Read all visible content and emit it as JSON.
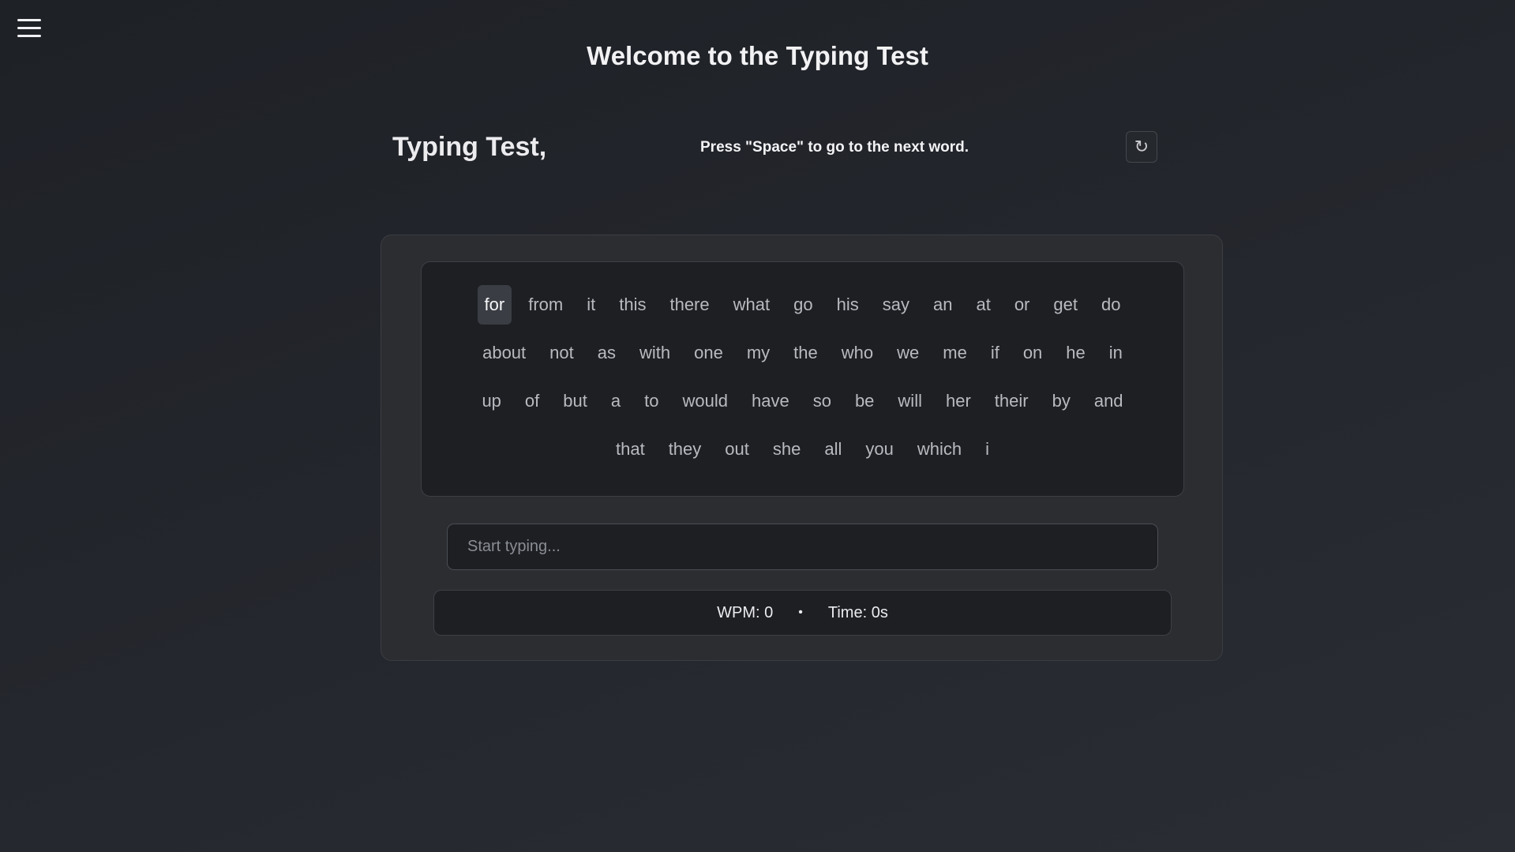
{
  "page": {
    "welcome_title": "Welcome to the Typing Test"
  },
  "menu": {
    "icon": "hamburger-menu-icon"
  },
  "header": {
    "brand": "Typing Test,",
    "hint": "Press \"Space\" to go to the next word.",
    "reset_icon": "↻"
  },
  "words": {
    "active_index": 0,
    "lines": [
      [
        "for",
        "from",
        "it",
        "this",
        "there",
        "what",
        "go",
        "his",
        "say",
        "an",
        "at",
        "or",
        "get",
        "do"
      ],
      [
        "about",
        "not",
        "as",
        "with",
        "one",
        "my",
        "the",
        "who",
        "we",
        "me",
        "if",
        "on",
        "he",
        "in"
      ],
      [
        "up",
        "of",
        "but",
        "a",
        "to",
        "would",
        "have",
        "so",
        "be",
        "will",
        "her",
        "their",
        "by",
        "and"
      ],
      [
        "that",
        "they",
        "out",
        "she",
        "all",
        "you",
        "which",
        "i"
      ]
    ]
  },
  "input": {
    "placeholder": "Start typing...",
    "value": ""
  },
  "stats": {
    "wpm": "WPM: 0",
    "separator": "•",
    "time": "Time: 0s"
  },
  "colors": {
    "background": "#23262c",
    "card": "#2b2d31",
    "panel": "#1d1f23",
    "active_word": "#3a3d44"
  }
}
